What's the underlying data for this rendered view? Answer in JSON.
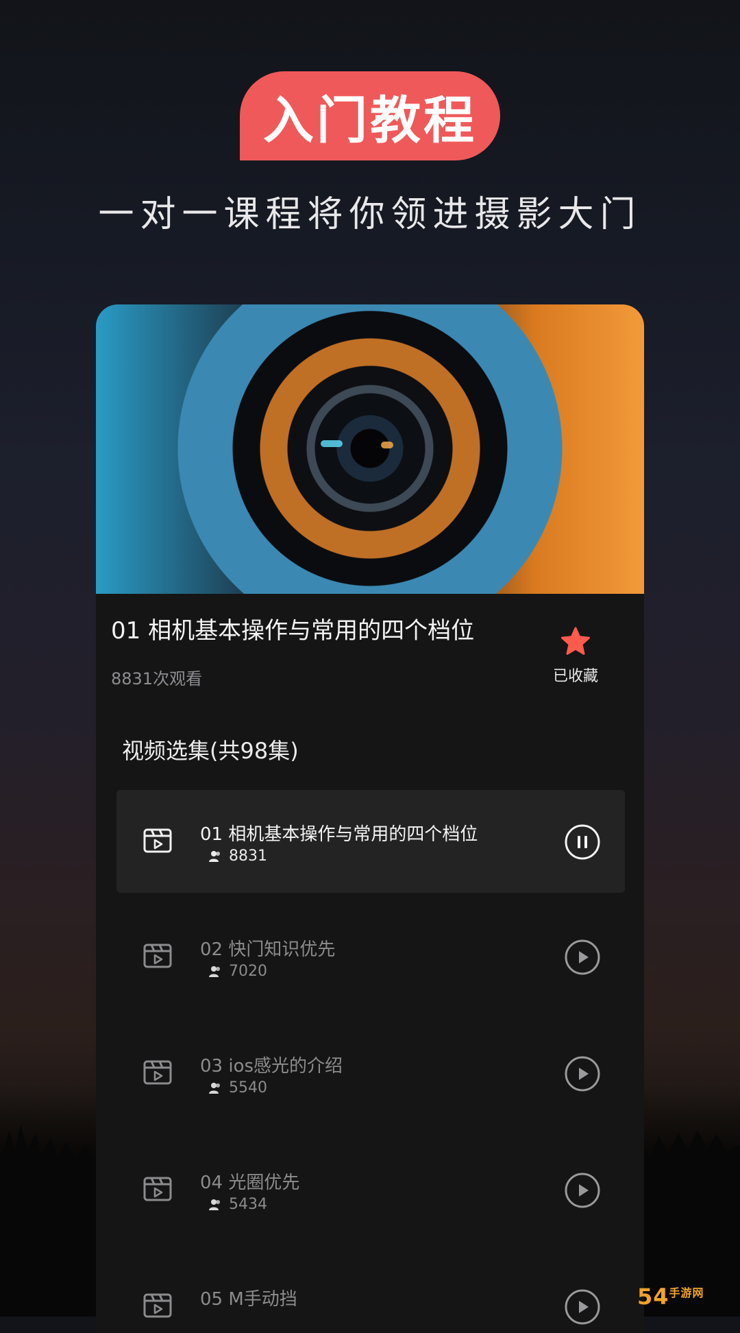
{
  "hero": {
    "badge": "入门教程",
    "subtitle": "一对一课程将你领进摄影大门"
  },
  "course": {
    "cover_image": "camera-lens-closeup",
    "title": "01 相机基本操作与常用的四个档位",
    "views": "8831次观看",
    "favorite_label": "已收藏"
  },
  "episodes": {
    "section_title": "视频选集(共98集)",
    "items": [
      {
        "title": "01 相机基本操作与常用的四个档位",
        "count": "8831",
        "state": "playing"
      },
      {
        "title": "02 快门知识优先",
        "count": "7020",
        "state": "paused"
      },
      {
        "title": "03 ios感光的介绍",
        "count": "5540",
        "state": "paused"
      },
      {
        "title": "04 光圈优先",
        "count": "5434",
        "state": "paused"
      },
      {
        "title": "05 M手动挡",
        "count": "",
        "state": "paused"
      }
    ]
  },
  "watermark": {
    "text": "54",
    "suffix": "手游网"
  },
  "colors": {
    "accent": "#f0595a",
    "card_bg": "#151515",
    "active_row_bg": "#232323",
    "star": "#ff5a4e"
  }
}
